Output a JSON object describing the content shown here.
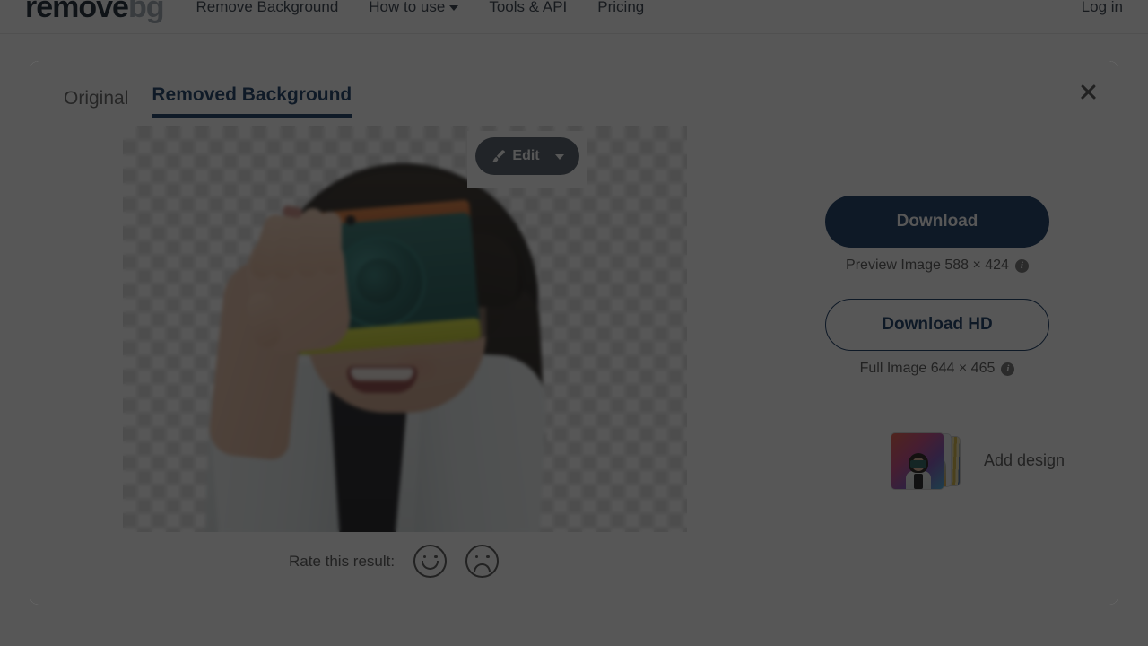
{
  "navbar": {
    "logo": {
      "part_dark": "remove",
      "part_grey": "bg"
    },
    "links": [
      {
        "label": "Remove Background",
        "has_caret": false
      },
      {
        "label": "How to use",
        "has_caret": true
      },
      {
        "label": "Tools & API",
        "has_caret": false
      },
      {
        "label": "Pricing",
        "has_caret": false
      }
    ],
    "login_label": "Log in"
  },
  "modal": {
    "close_icon": "close-icon",
    "tabs": [
      {
        "label": "Original",
        "active": false
      },
      {
        "label": "Removed Background",
        "active": true
      }
    ],
    "edit": {
      "label": "Edit",
      "icon": "paintbrush-icon",
      "caret_icon": "chevron-down-icon"
    },
    "download": {
      "primary_label": "Download",
      "primary_caption": "Preview Image 588 × 424",
      "primary_info_icon": "info-icon",
      "hd_label": "Download HD",
      "hd_caption": "Full Image 644 × 465",
      "hd_info_icon": "info-icon"
    },
    "add_design": {
      "label": "Add design",
      "thumbnails_icon": "design-templates-thumbnail-stack"
    },
    "rate": {
      "label": "Rate this result:",
      "happy_icon": "smiley-face-icon",
      "sad_icon": "frowning-face-icon"
    }
  },
  "colors": {
    "brand_navy": "#0d2f5c",
    "tab_active": "#10355f",
    "edit_button": "#4a5561",
    "body_text": "#4d4d4d",
    "backdrop": "rgba(15,15,15,0.70)"
  }
}
